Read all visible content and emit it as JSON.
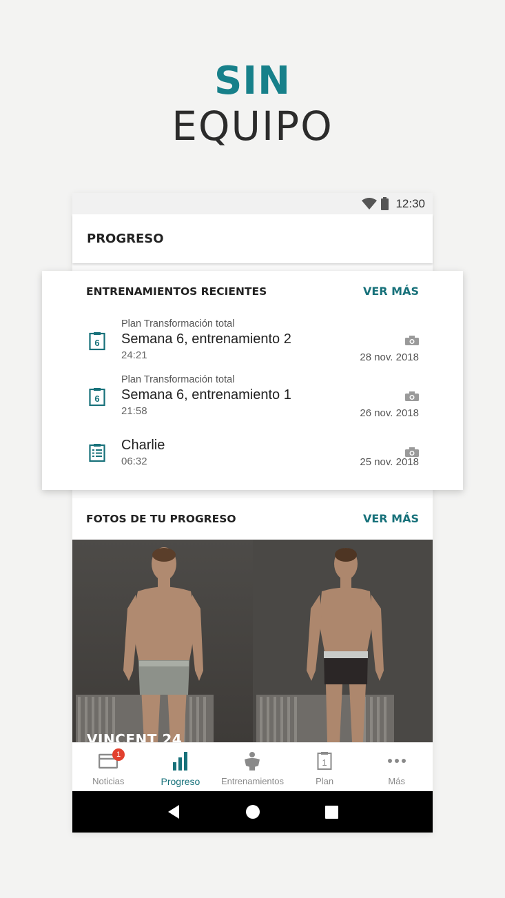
{
  "headline": {
    "line1": "SIN",
    "line2": "EQUIPO"
  },
  "status_bar": {
    "time": "12:30"
  },
  "app_bar": {
    "title": "PROGRESO"
  },
  "recent_workouts": {
    "title": "ENTRENAMIENTOS RECIENTES",
    "see_more": "VER MÁS",
    "items": [
      {
        "plan": "Plan Transformación total",
        "name": "Semana 6, entrenamiento 2",
        "duration": "24:21",
        "date": "28 nov. 2018",
        "icon": "plan-week-icon",
        "icon_number": "6"
      },
      {
        "plan": "Plan Transformación total",
        "name": "Semana 6, entrenamiento 1",
        "duration": "21:58",
        "date": "26 nov. 2018",
        "icon": "plan-week-icon",
        "icon_number": "6"
      },
      {
        "plan": "",
        "name": "Charlie",
        "duration": "06:32",
        "date": "25 nov. 2018",
        "icon": "workout-list-icon"
      }
    ]
  },
  "progress_photos": {
    "title": "FOTOS DE TU PROGRESO",
    "see_more": "VER MÁS",
    "name": "VINCENT 24"
  },
  "bottom_nav": {
    "items": [
      {
        "label": "Noticias",
        "icon": "news-icon",
        "badge": "1"
      },
      {
        "label": "Progreso",
        "icon": "bar-chart-icon",
        "active": true
      },
      {
        "label": "Entrenamientos",
        "icon": "figure-icon"
      },
      {
        "label": "Plan",
        "icon": "calendar-day-icon",
        "number": "1"
      },
      {
        "label": "Más",
        "icon": "more-dots-icon"
      }
    ]
  },
  "colors": {
    "accent": "#17717a",
    "headline_accent": "#17808a",
    "badge": "#e2412f"
  }
}
